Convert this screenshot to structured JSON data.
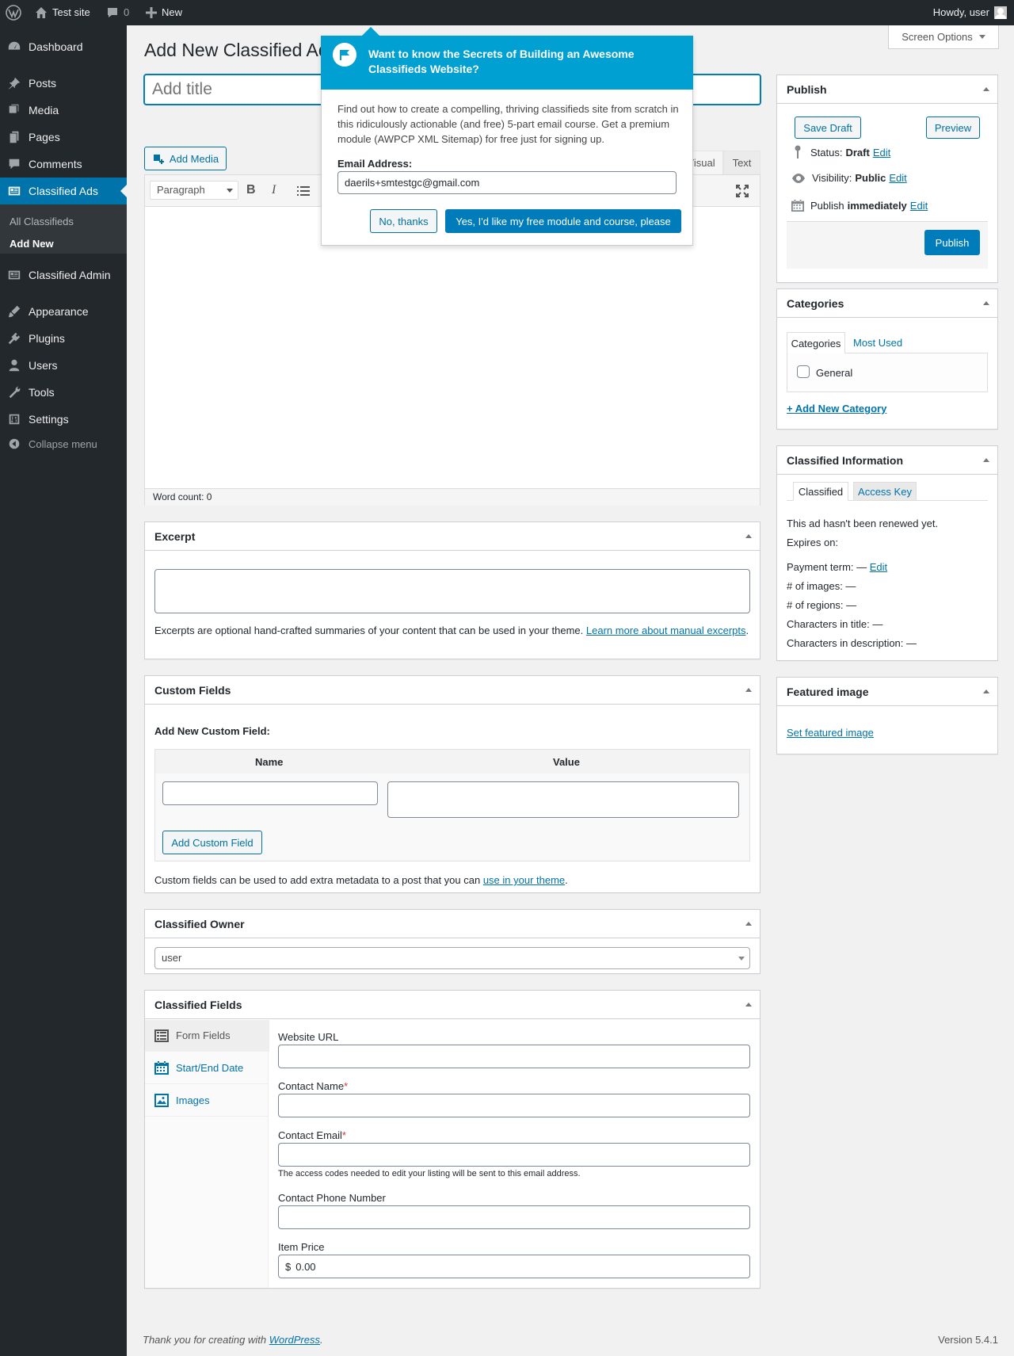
{
  "adminbar": {
    "site_name": "Test site",
    "comments_count": "0",
    "new_label": "New",
    "howdy": "Howdy, user"
  },
  "sidebar": {
    "items": [
      {
        "label": "Dashboard",
        "icon": "dashboard-icon"
      },
      {
        "label": "Posts",
        "icon": "pin-icon"
      },
      {
        "label": "Media",
        "icon": "media-icon"
      },
      {
        "label": "Pages",
        "icon": "pages-icon"
      },
      {
        "label": "Comments",
        "icon": "comments-icon"
      },
      {
        "label": "Classified Ads",
        "icon": "classified-icon"
      },
      {
        "label": "Classified Admin",
        "icon": "classified-admin-icon"
      },
      {
        "label": "Appearance",
        "icon": "appearance-icon"
      },
      {
        "label": "Plugins",
        "icon": "plugins-icon"
      },
      {
        "label": "Users",
        "icon": "users-icon"
      },
      {
        "label": "Tools",
        "icon": "tools-icon"
      },
      {
        "label": "Settings",
        "icon": "settings-icon"
      }
    ],
    "submenu": [
      "All Classifieds",
      "Add New"
    ],
    "collapse": "Collapse menu"
  },
  "screen_options": "Screen Options",
  "page_title": "Add New Classified Ad",
  "title_placeholder": "Add title",
  "editor": {
    "add_media": "Add Media",
    "tab_visual": "Visual",
    "tab_text": "Text",
    "format_select": "Paragraph",
    "word_count": "Word count: 0"
  },
  "popup": {
    "heading": "Want to know the Secrets of Building an Awesome Classifieds Website?",
    "body": "Find out how to create a compelling, thriving classifieds site from scratch in this ridiculously actionable (and free) 5-part email course. Get a premium module (AWPCP XML Sitemap) for free just for signing up.",
    "email_label": "Email Address:",
    "email_value": "daerils+smtestgc@gmail.com",
    "no_label": "No, thanks",
    "yes_label": "Yes, I'd like my free module and course, please"
  },
  "excerpt": {
    "title": "Excerpt",
    "help": "Excerpts are optional hand-crafted summaries of your content that can be used in your theme.",
    "link": "Learn more about manual excerpts",
    "dot": "."
  },
  "custom_fields": {
    "title": "Custom Fields",
    "add_new": "Add New Custom Field:",
    "col_name": "Name",
    "col_value": "Value",
    "add_button": "Add Custom Field",
    "help": "Custom fields can be used to add extra metadata to a post that you can",
    "link": "use in your theme",
    "dot": "."
  },
  "owner": {
    "title": "Classified Owner",
    "value": "user"
  },
  "classified_fields": {
    "title": "Classified Fields",
    "tabs": [
      "Form Fields",
      "Start/End Date",
      "Images"
    ],
    "website_label": "Website URL",
    "contact_name_label": "Contact Name",
    "contact_email_label": "Contact Email",
    "required_mark": "*",
    "email_help": "The access codes needed to edit your listing will be sent to this email address.",
    "phone_label": "Contact Phone Number",
    "price_label": "Item Price",
    "currency": "$",
    "price_value": "0.00"
  },
  "publish": {
    "title": "Publish",
    "save_draft": "Save Draft",
    "preview": "Preview",
    "status_label": "Status:",
    "status_value": "Draft",
    "visibility_label": "Visibility:",
    "visibility_value": "Public",
    "publish_label": "Publish",
    "publish_value": "immediately",
    "edit": "Edit",
    "publish_button": "Publish"
  },
  "categories": {
    "title": "Categories",
    "tab_all": "Categories",
    "tab_used": "Most Used",
    "item": "General",
    "add_new": "+ Add New Category"
  },
  "classified_info": {
    "title": "Classified Information",
    "tab_classified": "Classified",
    "tab_access": "Access Key",
    "renewed": "This ad hasn't been renewed yet.",
    "expires": "Expires on:",
    "payment_term": "Payment term: —",
    "edit": "Edit",
    "images": "# of images: —",
    "regions": "# of regions: —",
    "chars_title": "Characters in title: —",
    "chars_desc": "Characters in description: —"
  },
  "featured": {
    "title": "Featured image",
    "link": "Set featured image"
  },
  "footer": {
    "thanks": "Thank you for creating with",
    "wp_link": "WordPress",
    "dot": ".",
    "version": "Version 5.4.1"
  },
  "colors": {
    "admin_bar": "#23282d",
    "accent": "#0073aa",
    "popup_header": "#00a0d2"
  }
}
